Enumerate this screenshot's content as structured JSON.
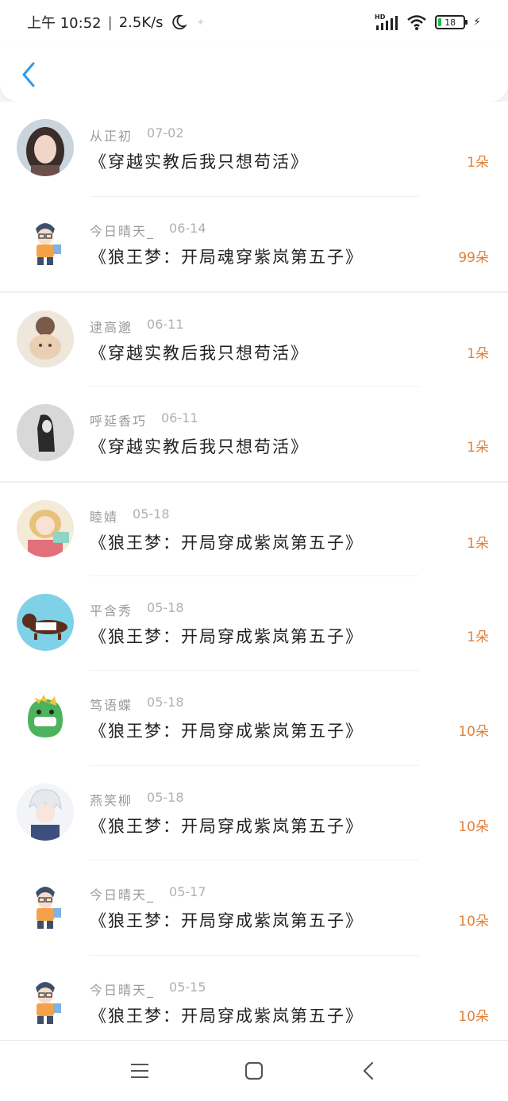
{
  "status_bar": {
    "time": "上午 10:52",
    "net_speed": "2.5K/s",
    "battery": "18",
    "network_badge": "HD"
  },
  "header": {
    "back_icon": "chevron-left-icon"
  },
  "entries": [
    {
      "user": "从正初",
      "date": "07-02",
      "title": "《穿越实教后我只想苟活》",
      "count": "1朵",
      "avatar": "girl-photo"
    },
    {
      "user": "今日晴天_",
      "date": "06-14",
      "title": "《狼王梦：开局魂穿紫岚第五子》",
      "count": "99朵",
      "avatar": "cartoon-boy"
    },
    {
      "user": "逮高邈",
      "date": "06-11",
      "title": "《穿越实教后我只想苟活》",
      "count": "1朵",
      "avatar": "girl-hugging-bear"
    },
    {
      "user": "呼延香巧",
      "date": "06-11",
      "title": "《穿越实教后我只想苟活》",
      "count": "1朵",
      "avatar": "girl-monochrome"
    },
    {
      "user": "睦婧",
      "date": "05-18",
      "title": "《狼王梦：开局穿成紫岚第五子》",
      "count": "1朵",
      "avatar": "anime-girl"
    },
    {
      "user": "平含秀",
      "date": "05-18",
      "title": "《狼王梦：开局穿成紫岚第五子》",
      "count": "1朵",
      "avatar": "dachshund"
    },
    {
      "user": "笃语蝶",
      "date": "05-18",
      "title": "《狼王梦：开局穿成紫岚第五子》",
      "count": "10朵",
      "avatar": "green-dino"
    },
    {
      "user": "燕笑柳",
      "date": "05-18",
      "title": "《狼王梦：开局穿成紫岚第五子》",
      "count": "10朵",
      "avatar": "anime-white-hair"
    },
    {
      "user": "今日晴天_",
      "date": "05-17",
      "title": "《狼王梦：开局穿成紫岚第五子》",
      "count": "10朵",
      "avatar": "cartoon-boy"
    },
    {
      "user": "今日晴天_",
      "date": "05-15",
      "title": "《狼王梦：开局穿成紫岚第五子》",
      "count": "10朵",
      "avatar": "cartoon-boy"
    }
  ],
  "nav_bar": {
    "menu_icon": "menu-icon",
    "home_icon": "home-square-icon",
    "back_icon": "back-triangle-icon"
  },
  "colors": {
    "accent_blue": "#2f9bea",
    "count_orange": "#e0813a"
  }
}
